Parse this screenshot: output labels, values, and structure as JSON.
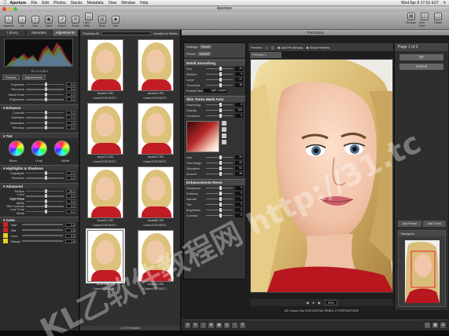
{
  "menubar": {
    "items": [
      "Aperture",
      "File",
      "Edit",
      "Photos",
      "Stacks",
      "Metadata",
      "View",
      "Window",
      "Help"
    ],
    "clock": "Wed Apr 8 27:53 EST"
  },
  "window": {
    "title": "Aperture"
  },
  "toolbar": {
    "buttons": [
      "Inspector",
      "Lift",
      "New",
      "Vault",
      "Export",
      "Email",
      "Light Table",
      "Book",
      "Web"
    ],
    "right_buttons": [
      "Browser",
      "Split View",
      "Viewer"
    ]
  },
  "inspector": {
    "tabs": [
      "Library",
      "Metadata",
      "Adjustments"
    ],
    "histogram_info": "R:0 G:0 B:0",
    "presets_label": "Presets",
    "adjustments_label": "Adjustments",
    "rows_top": [
      {
        "label": "Exposure",
        "value": "0.0"
      },
      {
        "label": "Recovery",
        "value": "0.0"
      },
      {
        "label": "Black Point",
        "value": "0.0"
      },
      {
        "label": "Brightness",
        "value": "0.0"
      }
    ],
    "enhance_title": "Enhance",
    "rows_enhance": [
      {
        "label": "Contrast",
        "value": "0.0"
      },
      {
        "label": "Definition",
        "value": "0.0"
      },
      {
        "label": "Saturation",
        "value": "1.0"
      },
      {
        "label": "Vibrancy",
        "value": "0.0"
      }
    ],
    "tint_title": "Tint",
    "wheel_labels": [
      "Black",
      "Gray",
      "White"
    ],
    "hs_title": "Highlights & Shadows",
    "rows_hs": [
      {
        "label": "Highlights",
        "value": "0.0"
      },
      {
        "label": "Shadows",
        "value": "0.0"
      }
    ],
    "advanced_title": "Advanced",
    "rows_adv": [
      {
        "label": "Radius",
        "value": "30.0"
      },
      {
        "label": "Color Correction",
        "value": "0.0"
      },
      {
        "label": "High Tonal Width",
        "value": "0.0"
      },
      {
        "label": "Mid Contrast",
        "value": "0.0"
      },
      {
        "label": "Low Tonal Width",
        "value": "0.0"
      }
    ],
    "color_title": "Color",
    "color_rows": [
      {
        "label": "Hue",
        "value": "0.0"
      },
      {
        "label": "Sat",
        "value": "0.0"
      },
      {
        "label": "Lum",
        "value": "0.0"
      },
      {
        "label": "Range",
        "value": "1.0"
      }
    ],
    "colors": {
      "red": "#d42020",
      "yellow": "#e6d020"
    }
  },
  "browser": {
    "filter": "Showing All",
    "selected_label": "Unrated or Better",
    "thumbs": [
      {
        "name": "shoot91.CR2",
        "camera": "Canon EOS DIGIT..."
      },
      {
        "name": "shoot04.CR2",
        "camera": "Canon EOS DIGIT..."
      },
      {
        "name": "shoot71.CR2",
        "camera": "Canon EOS DIGIT..."
      },
      {
        "name": "shoot97.CR2",
        "camera": "Canon EOS DIGIT..."
      },
      {
        "name": "shoot31.CR2",
        "camera": "Canon EOS DIGIT..."
      },
      {
        "name": "shoot88.CR2",
        "camera": "Canon EOS DIGIT..."
      },
      {
        "name": "shoot19.CLLR",
        "camera": "Canon EOS DIGIT..."
      },
      {
        "name": "shoot11.CR2",
        "camera": "Canon EOS DIGIT..."
      }
    ],
    "footer": "1 of 20 Selected"
  },
  "viewer": {
    "title": "Portraiture"
  },
  "portraiture": {
    "settings_label": "Settings",
    "reset_label": "Reset",
    "preset_label": "Preset",
    "preset_value": "Default",
    "detail_title": "Detail Smoothing",
    "detail_rows": [
      {
        "label": "Fine",
        "value": "-10"
      },
      {
        "label": "Medium",
        "value": "0"
      },
      {
        "label": "Large",
        "value": "-17"
      },
      {
        "label": "Threshold",
        "value": "18"
      }
    ],
    "portrait_size_label": "Portrait Size",
    "portrait_size_value": "Light Largest",
    "mask_title": "Skin Tones Mask",
    "mask_auto": "Auto",
    "mask_rows": [
      {
        "label": "Feathering",
        "value": "0"
      },
      {
        "label": "Opacity",
        "value": "100"
      },
      {
        "label": "Fuzziness",
        "value": "0"
      }
    ],
    "mask_hsl": [
      {
        "label": "Hue",
        "value": "20"
      },
      {
        "label": "Hue Range",
        "value": "34"
      },
      {
        "label": "Saturation",
        "value": "51"
      },
      {
        "label": "Amount",
        "value": "46"
      }
    ],
    "enh_title": "Enhancements",
    "enh_reset": "Reset",
    "enh_rows": [
      {
        "label": "Sharpness",
        "value": "0"
      },
      {
        "label": "Softness",
        "value": "0"
      },
      {
        "label": "Warmth",
        "value": "0"
      },
      {
        "label": "Tint",
        "value": "0"
      },
      {
        "label": "Brightness",
        "value": "0"
      },
      {
        "label": "Contrast",
        "value": "0"
      }
    ],
    "preview_label": "Preview",
    "preview_tab": "Preview 1",
    "add_preview_label": "Add Pre Beauty",
    "show_preview": "Show Preview",
    "page_label": "Page 1 of 2",
    "ok_label": "OK",
    "cancel_label": "Cancel",
    "add_preset_label": "Add Preset",
    "add_fresh_label": "Add Fresh",
    "navigator_title": "Navigator",
    "zoom": "25%",
    "caption": "AS Canon Can EOS DIGITAL REBEL 2 PORTRAITURE"
  },
  "watermark": "KL乙软件教程网 http://31.tc"
}
